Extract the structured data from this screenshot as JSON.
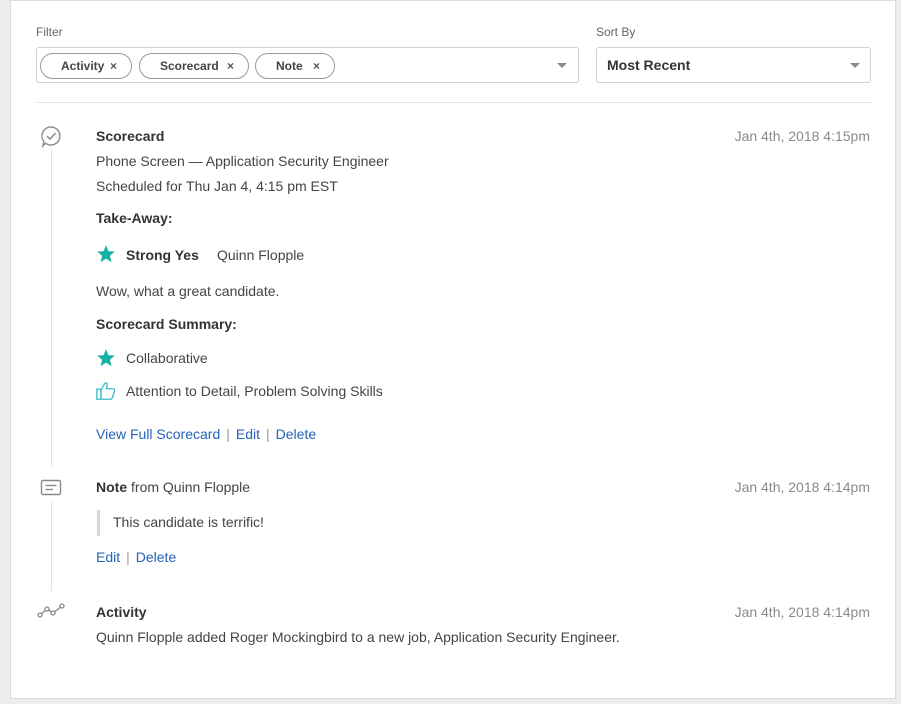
{
  "filter": {
    "label": "Filter",
    "chips": [
      "Activity",
      "Scorecard",
      "Note"
    ],
    "chip_remove": "×"
  },
  "sort": {
    "label": "Sort By",
    "value": "Most Recent"
  },
  "timeline": {
    "scorecard": {
      "title": "Scorecard",
      "date": "Jan 4th, 2018 4:15pm",
      "subtitle": "Phone Screen — Application Security Engineer",
      "scheduled": "Scheduled for Thu Jan 4, 4:15 pm EST",
      "takeaway_label": "Take-Away:",
      "rating": "Strong Yes",
      "interviewer": "Quinn Flopple",
      "comment": "Wow, what a great candidate.",
      "summary_label": "Scorecard Summary:",
      "summary_strong": "Collaborative",
      "summary_good": "Attention to Detail, Problem Solving Skills",
      "actions": {
        "view": "View Full Scorecard",
        "edit": "Edit",
        "delete": "Delete",
        "separator": "|"
      }
    },
    "note": {
      "title": "Note",
      "from": "from Quinn Flopple",
      "date": "Jan 4th, 2018 4:14pm",
      "body": "This candidate is terrific!",
      "actions": {
        "edit": "Edit",
        "delete": "Delete",
        "separator": "|"
      }
    },
    "activity": {
      "title": "Activity",
      "date": "Jan 4th, 2018 4:14pm",
      "body": "Quinn Flopple added Roger Mockingbird to a new job, Application Security Engineer."
    }
  },
  "colors": {
    "link": "#2463b5",
    "star": "#15b3a3",
    "thumb": "#3fb8c7"
  }
}
